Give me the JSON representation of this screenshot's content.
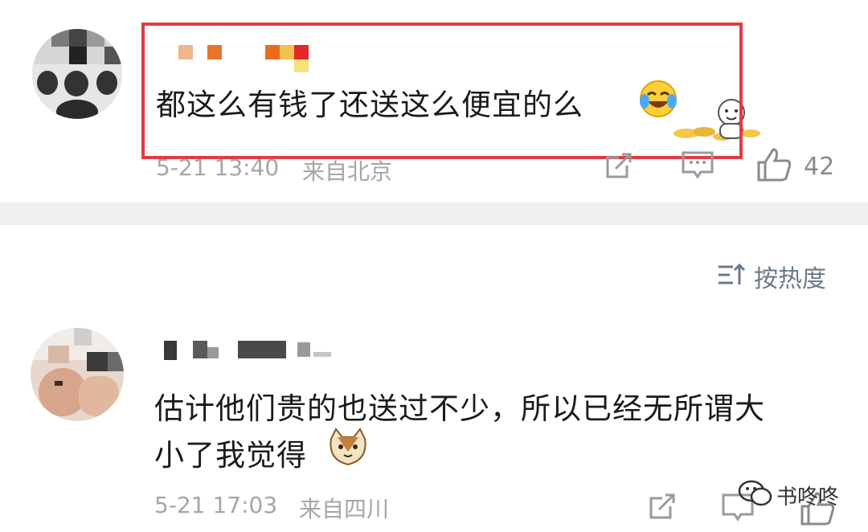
{
  "comment1": {
    "text": "都这么有钱了还送这么便宜的么",
    "emoji_icon": "laugh-cry-emoji",
    "sticker_icon": "gold-ingot-sticker",
    "date": "5-21 13:40",
    "location": "来自北京",
    "like_count": "42"
  },
  "sort": {
    "label": "按热度"
  },
  "comment2": {
    "text_line1": "估计他们贵的也送过不少，所以已经无所谓大",
    "text_line2": "小了我觉得",
    "emoji_icon": "cat-face-emoji",
    "date": "5-21 17:03",
    "location": "来自四川"
  },
  "watermark": {
    "text": "书咚咚"
  },
  "colors": {
    "highlight": "#e23b45",
    "meta": "#a6a6a6",
    "sort": "#6b7a89"
  }
}
